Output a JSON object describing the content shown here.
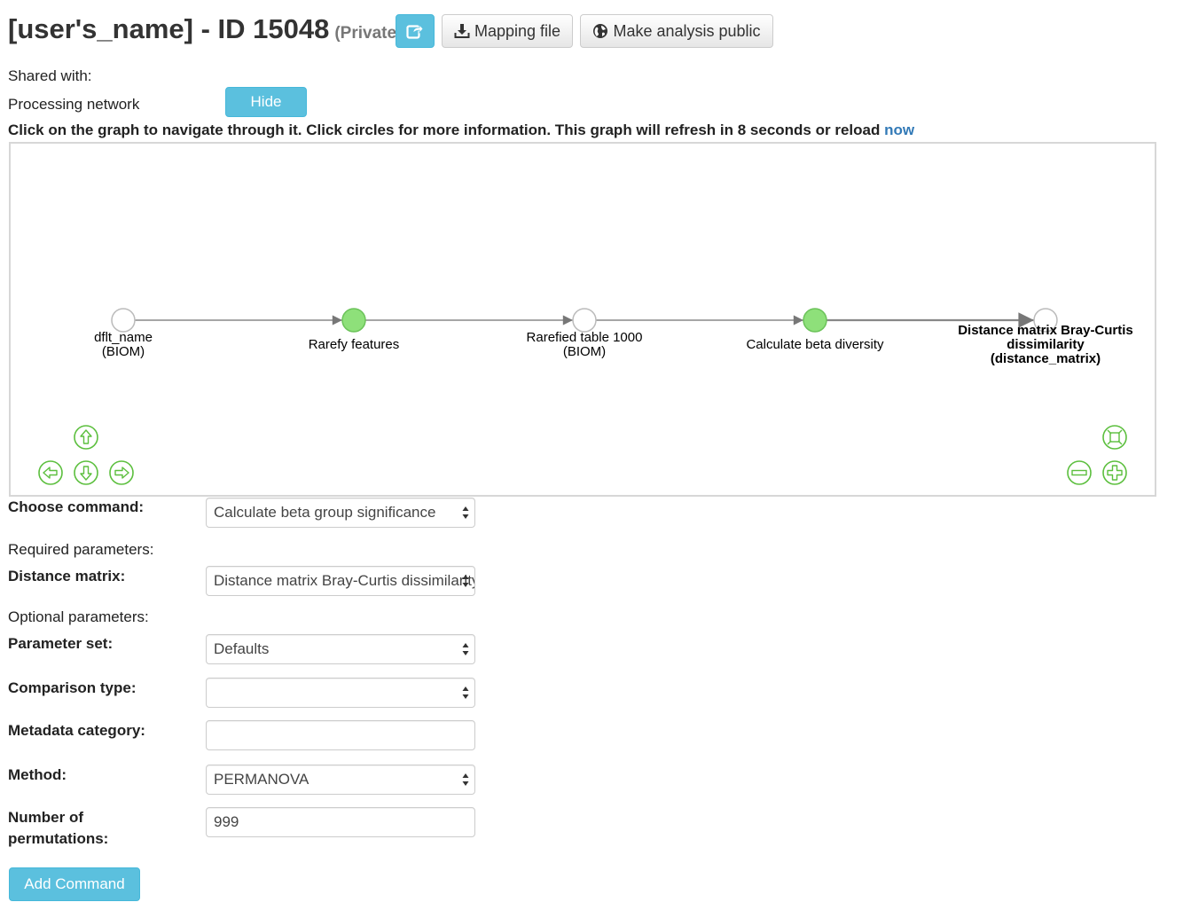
{
  "header": {
    "title": "[user's_name] - ID 15048",
    "privacy": "(Private)",
    "mapping_label": "Mapping file",
    "public_label": "Make analysis public",
    "share_icon": "share-icon",
    "download_icon": "download-icon",
    "globe_icon": "globe-icon"
  },
  "shared_with_label": "Shared with:",
  "processing": {
    "label": "Processing network",
    "hide_label": "Hide"
  },
  "instructions": {
    "text": "Click on the graph to navigate through it. Click circles for more information. This graph will refresh in 8 seconds or reload ",
    "link": "now"
  },
  "graph": {
    "nodes": [
      {
        "id": "n1",
        "type": "artifact",
        "label_lines": [
          "dflt_name",
          "(BIOM)"
        ]
      },
      {
        "id": "n2",
        "type": "job",
        "label_lines": [
          "Rarefy features"
        ]
      },
      {
        "id": "n3",
        "type": "artifact",
        "label_lines": [
          "Rarefied table 1000",
          "(BIOM)"
        ]
      },
      {
        "id": "n4",
        "type": "job",
        "label_lines": [
          "Calculate beta diversity"
        ]
      },
      {
        "id": "n5",
        "type": "artifact",
        "selected": true,
        "label_lines": [
          "Distance matrix Bray-Curtis",
          "dissimilarity",
          "(distance_matrix)"
        ]
      }
    ],
    "colors": {
      "job": "#8ee07a",
      "artifact": "#ffffff",
      "edge": "#888888",
      "nav": "#5cbf3e"
    },
    "nav_icons": [
      "pan-up-icon",
      "pan-left-icon",
      "pan-down-icon",
      "pan-right-icon",
      "fit-icon",
      "zoom-out-icon",
      "zoom-in-icon"
    ]
  },
  "form": {
    "choose_command_label": "Choose command:",
    "choose_command_value": "Calculate beta group significance",
    "required_label": "Required parameters:",
    "distance_matrix_label": "Distance matrix:",
    "distance_matrix_value": "Distance matrix Bray-Curtis dissimilarity",
    "optional_label": "Optional parameters:",
    "parameter_set_label": "Parameter set:",
    "parameter_set_value": "Defaults",
    "comparison_type_label": "Comparison type:",
    "comparison_type_value": "",
    "metadata_category_label": "Metadata category:",
    "metadata_category_value": "",
    "method_label": "Method:",
    "method_value": "PERMANOVA",
    "permutations_label_line1": "Number of",
    "permutations_label_line2": "permutations:",
    "permutations_value": "999",
    "add_command_label": "Add Command"
  }
}
